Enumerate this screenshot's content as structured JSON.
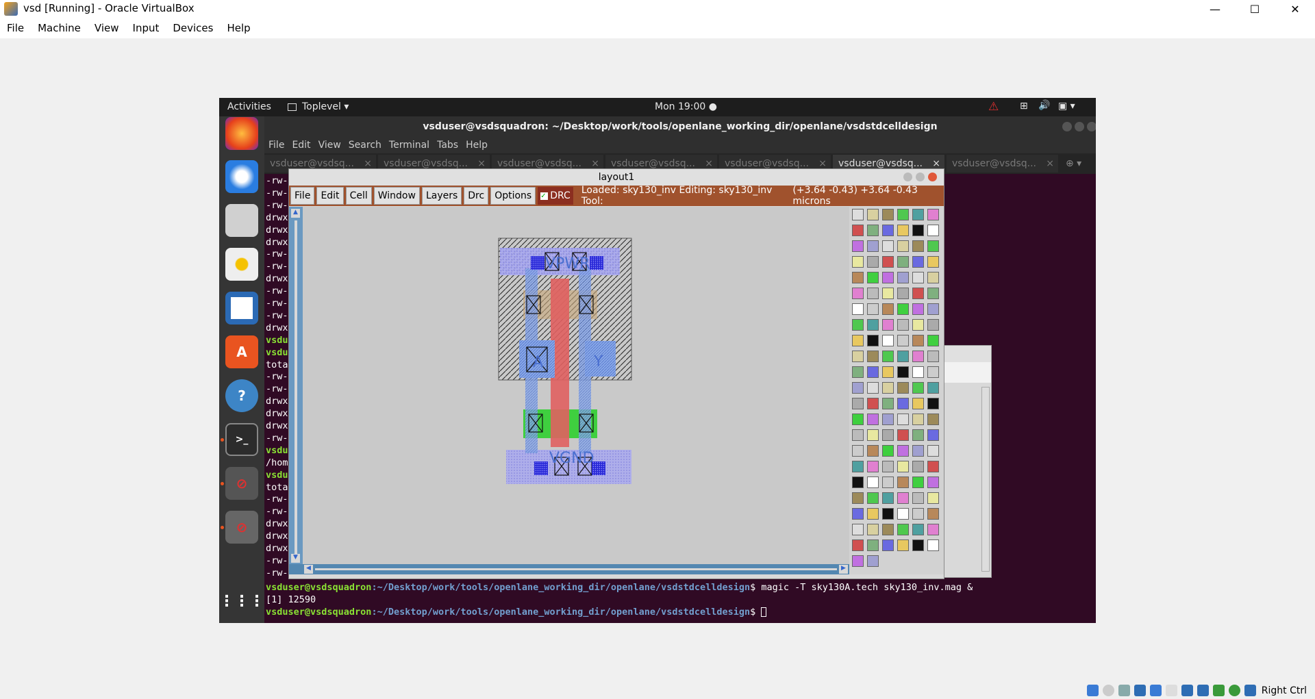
{
  "host": {
    "title": "vsd [Running] - Oracle VirtualBox",
    "menu": [
      "File",
      "Machine",
      "View",
      "Input",
      "Devices",
      "Help"
    ],
    "status_right": "Right Ctrl"
  },
  "ubuntu": {
    "activities": "Activities",
    "app_menu": "Toplevel ▾",
    "clock": "Mon 19:00 ●"
  },
  "terminal": {
    "title": "vsduser@vsdsquadron: ~/Desktop/work/tools/openlane_working_dir/openlane/vsdstdcelldesign",
    "menu": [
      "File",
      "Edit",
      "View",
      "Search",
      "Terminal",
      "Tabs",
      "Help"
    ],
    "tabs": [
      "vsduser@vsdsq...",
      "vsduser@vsdsq...",
      "vsduser@vsdsq...",
      "vsduser@vsdsq...",
      "vsduser@vsdsq...",
      "vsduser@vsdsq...",
      "vsduser@vsdsq..."
    ],
    "active_tab": 5,
    "left_lines": [
      "-rw-",
      "-rw-",
      "-rw-",
      "drwx",
      "drwx",
      "drwx",
      "-rw-",
      "-rw-",
      "drwx",
      "-rw-",
      "-rw-",
      "-rw-",
      "drwx",
      "vsdu",
      "vsdu",
      "tota",
      "-rw-",
      "-rw-",
      "drwx",
      "drwx",
      "drwx",
      "-rw-",
      "vsdu",
      "/hom",
      "vsdu",
      "tota",
      "-rw-",
      "-rw-",
      "drwx",
      "drwx",
      "drwx",
      "-rw-",
      "-rw-"
    ],
    "prompt_user": "vsduser@vsdsquadron",
    "prompt_path": ":~/Desktop/work/tools/openlane_working_dir/openlane/vsdstdcelldesign",
    "command1": "$ magic -T sky130A.tech sky130_inv.mag &",
    "job_line": "[1] 12590",
    "command2": "$ "
  },
  "magic": {
    "title": "layout1",
    "menu": [
      "File",
      "Edit",
      "Cell",
      "Window",
      "Layers",
      "Drc",
      "Options"
    ],
    "drc_label": "DRC",
    "status": "Loaded: sky130_inv Editing: sky130_inv Tool:",
    "coords": "(+3.64 -0.43) +3.64 -0.43 microns",
    "labels": {
      "pwr": "VPWR",
      "gnd": "VGND",
      "a": "A",
      "y": "Y"
    }
  },
  "icons": {
    "dock": [
      "firefox-icon",
      "thunderbird-icon",
      "files-icon",
      "rhythmbox-icon",
      "writer-icon",
      "software-icon",
      "help-icon",
      "terminal-icon",
      "blocked-app-icon",
      "blocked-app-icon",
      "show-apps-icon"
    ]
  }
}
